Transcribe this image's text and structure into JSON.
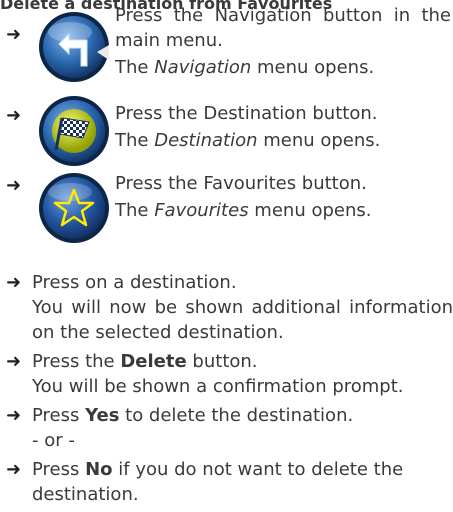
{
  "heading_fragment": "Delete a destination from Favourites",
  "steps_with_icons": [
    {
      "action": "Press the Navigation button in the main menu.",
      "result_prefix": "The ",
      "result_em": "Navigation",
      "result_suffix": " menu opens.",
      "icon": "navigation-arrow-icon"
    },
    {
      "action": "Press the Destination button.",
      "result_prefix": "The ",
      "result_em": "Destination",
      "result_suffix": " menu opens.",
      "icon": "destination-flag-icon"
    },
    {
      "action": "Press the Favourites button.",
      "result_prefix": "The ",
      "result_em": "Favourites",
      "result_suffix": " menu opens.",
      "icon": "favourites-star-icon"
    }
  ],
  "list": {
    "s1": "Press on a destination.",
    "s1_result": "You will now be shown additional information on the selected destination.",
    "s2_pre": "Press the ",
    "s2_bold": "Delete",
    "s2_post": " button.",
    "s2_result": "You will be shown a confirmation prompt.",
    "s3_bold": "Yes",
    "s3_post": " to delete the destination.",
    "s3_pre": "Press ",
    "or": "- or -",
    "s4_pre": "Press ",
    "s4_bold": "No",
    "s4_post": " if you do not want to delete the destination."
  },
  "arrow_glyph": "➜",
  "colors": {
    "icon_ring": "#1b3c78",
    "icon_fill": "#2c6bb3",
    "flag_ball": "#c8d400",
    "text": "#3a3a3a"
  }
}
